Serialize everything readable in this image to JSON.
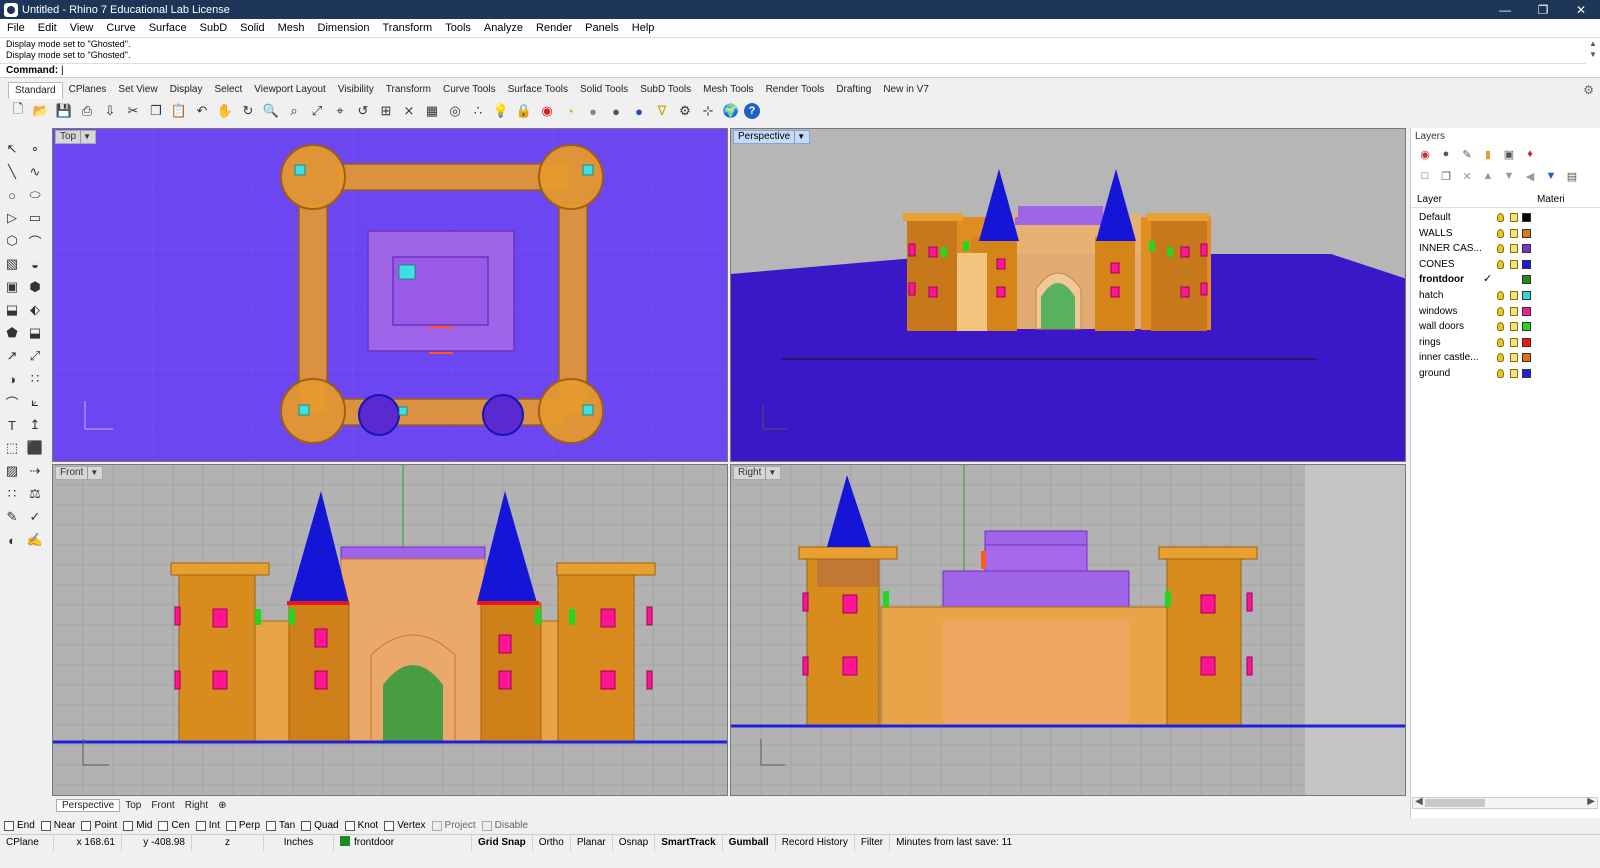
{
  "window": {
    "title": "Untitled - Rhino 7 Educational Lab License"
  },
  "menu": [
    "File",
    "Edit",
    "View",
    "Curve",
    "Surface",
    "SubD",
    "Solid",
    "Mesh",
    "Dimension",
    "Transform",
    "Tools",
    "Analyze",
    "Render",
    "Panels",
    "Help"
  ],
  "command": {
    "history": [
      "Display mode set to \"Ghosted\".",
      "Display mode set to \"Ghosted\"."
    ],
    "prompt": "Command:"
  },
  "toolbar_tabs": [
    "Standard",
    "CPlanes",
    "Set View",
    "Display",
    "Select",
    "Viewport Layout",
    "Visibility",
    "Transform",
    "Curve Tools",
    "Surface Tools",
    "Solid Tools",
    "SubD Tools",
    "Mesh Tools",
    "Render Tools",
    "Drafting",
    "New in V7"
  ],
  "toolbar_icons": [
    "new-file-icon",
    "open-file-icon",
    "save-icon",
    "print-icon",
    "import-icon",
    "cut-icon",
    "copy-icon",
    "paste-icon",
    "undo-icon",
    "pan-icon",
    "rotate-view-icon",
    "zoom-icon",
    "zoom-window-icon",
    "zoom-extents-icon",
    "zoom-selected-icon",
    "undo-view-icon",
    "four-viewports-icon",
    "cplane-icon",
    "grid-icon",
    "circle-snap-icon",
    "points-icon",
    "light-icon",
    "lock-icon",
    "materials-icon",
    "color-wheel-icon",
    "shaded-icon",
    "rendered-icon",
    "render-sphere-icon",
    "filter-icon",
    "settings-icon",
    "snap-icon",
    "globe-icon",
    "help-icon"
  ],
  "viewports": {
    "top": {
      "label": "Top"
    },
    "perspective": {
      "label": "Perspective"
    },
    "front": {
      "label": "Front"
    },
    "right": {
      "label": "Right"
    }
  },
  "viewport_tabs": [
    "Perspective",
    "Top",
    "Front",
    "Right"
  ],
  "layers_panel": {
    "title": "Layers",
    "col_layer": "Layer",
    "col_material": "Materi",
    "layers": [
      {
        "name": "Default",
        "color": "#000000"
      },
      {
        "name": "WALLS",
        "color": "#d97a10"
      },
      {
        "name": "INNER CAS...",
        "color": "#7b32c8"
      },
      {
        "name": "CONES",
        "color": "#1a1ad8"
      },
      {
        "name": "frontdoor",
        "color": "#1f8a1f",
        "current": true
      },
      {
        "name": "hatch",
        "color": "#30d8d8"
      },
      {
        "name": "windows",
        "color": "#e8209a"
      },
      {
        "name": "wall doors",
        "color": "#20d820"
      },
      {
        "name": "rings",
        "color": "#e81818"
      },
      {
        "name": "inner castle...",
        "color": "#e86a18"
      },
      {
        "name": "ground",
        "color": "#2020e0"
      }
    ]
  },
  "osnaps": [
    {
      "label": "End",
      "enabled": true
    },
    {
      "label": "Near",
      "enabled": true
    },
    {
      "label": "Point",
      "enabled": true
    },
    {
      "label": "Mid",
      "enabled": true
    },
    {
      "label": "Cen",
      "enabled": true
    },
    {
      "label": "Int",
      "enabled": true
    },
    {
      "label": "Perp",
      "enabled": true
    },
    {
      "label": "Tan",
      "enabled": true
    },
    {
      "label": "Quad",
      "enabled": true
    },
    {
      "label": "Knot",
      "enabled": true
    },
    {
      "label": "Vertex",
      "enabled": true
    },
    {
      "label": "Project",
      "enabled": false
    },
    {
      "label": "Disable",
      "enabled": false
    }
  ],
  "status": {
    "cplane": "CPlane",
    "x": "x 168.61",
    "y": "y -408.98",
    "z": "z",
    "units": "Inches",
    "layer": "frontdoor",
    "layer_color": "#1f8a1f",
    "grid_snap": "Grid Snap",
    "ortho": "Ortho",
    "planar": "Planar",
    "osnap": "Osnap",
    "smarttrack": "SmartTrack",
    "gumball": "Gumball",
    "record_history": "Record History",
    "filter": "Filter",
    "last_save": "Minutes from last save: 11"
  },
  "colors": {
    "wall": "#d98c1e",
    "cone": "#1515d8",
    "inner": "#9a5ae8",
    "window": "#ff1493",
    "ground": "#3a18c8",
    "top_bg": "#6c46f0",
    "door": "#2c9a3a"
  }
}
